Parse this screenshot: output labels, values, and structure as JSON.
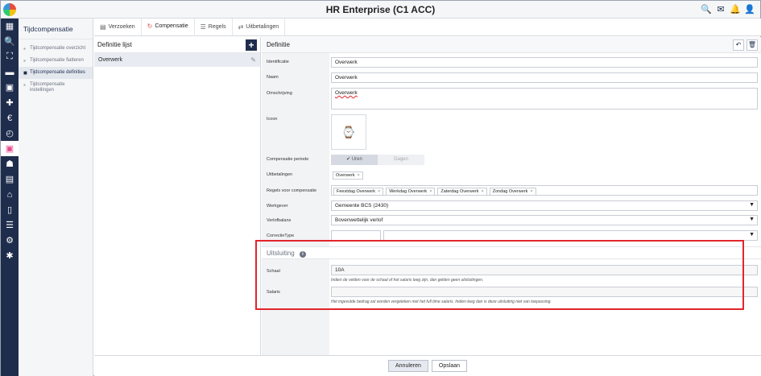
{
  "app": {
    "title": "HR Enterprise (C1 ACC)"
  },
  "titlebar_icons": [
    "search-user-icon",
    "mail-icon",
    "bell-icon",
    "person-icon"
  ],
  "rail_icons": [
    "apps-icon",
    "search-icon",
    "org-icon",
    "folder-icon",
    "calendar-icon",
    "plus-icon",
    "money-bag-icon",
    "timer-icon",
    "calendar-clock-icon",
    "person-icon",
    "id-card-icon",
    "institution-icon",
    "document-icon",
    "document-list-icon",
    "user-settings-icon",
    "gear-icon"
  ],
  "nav": {
    "title": "Tijdcompensatie",
    "items": [
      {
        "label": "Tijdcompensatie overzicht"
      },
      {
        "label": "Tijdcompensatie fiatteren"
      },
      {
        "label": "Tijdcompensatie definities"
      },
      {
        "label": "Tijdcompensatie instellingen"
      }
    ]
  },
  "tabs": [
    {
      "label": "Verzoeken",
      "icon": "document-icon"
    },
    {
      "label": "Compensatie",
      "icon": "cycle-icon"
    },
    {
      "label": "Regels",
      "icon": "list-icon"
    },
    {
      "label": "Uitbetalingen",
      "icon": "payment-icon"
    }
  ],
  "list": {
    "title": "Definitie lijst",
    "rows": [
      {
        "label": "Overwerk"
      }
    ]
  },
  "detail": {
    "title": "Definitie",
    "fields": {
      "identificatie": {
        "label": "Identificatie",
        "value": "Overwerk"
      },
      "naam": {
        "label": "Naam",
        "value": "Overwerk"
      },
      "omschrijving": {
        "label": "Omschrijving",
        "value": "Overwerk"
      },
      "icoon": {
        "label": "Icoon"
      },
      "compensatie_periode": {
        "label": "Compensatie periode",
        "options": [
          "✔ Uren",
          "Dagen"
        ]
      },
      "uitbetalingen": {
        "label": "Uitbetalingen",
        "chips": [
          "Overwerk"
        ]
      },
      "regels": {
        "label": "Regels voor compensatie",
        "chips": [
          "Feestdag Overwerk",
          "Werkdag Overwerk",
          "Zaterdag Overwerk",
          "Zondag Overwerk"
        ]
      },
      "werkgever": {
        "label": "Werkgever",
        "value": "Gemeente BCS (2430)"
      },
      "verlofbalans": {
        "label": "Verlofbalans",
        "value": "Bovenwettelijk verlof"
      },
      "correctietype": {
        "label": "CorrectieType",
        "value": ""
      }
    },
    "uitsluiting": {
      "title": "Uitsluiting",
      "schaal": {
        "label": "Schaal",
        "value": "10A",
        "hint": "Indien de velden voor de schaal of het salaris leeg zijn, dan gelden geen uitsluitingen."
      },
      "salaris": {
        "label": "Salaris",
        "value": "",
        "hint": "Het ingevulde bedrag zal worden vergeleken met het full time salaris. Indien leeg dan is deze uitsluiting niet van toepassing."
      }
    }
  },
  "footer": {
    "cancel_label": "Annuleren",
    "save_label": "Opslaan"
  },
  "colors": {
    "rail": "#1f2d4d",
    "highlight": "#e2252b",
    "active_icon": "#e84a8a"
  }
}
